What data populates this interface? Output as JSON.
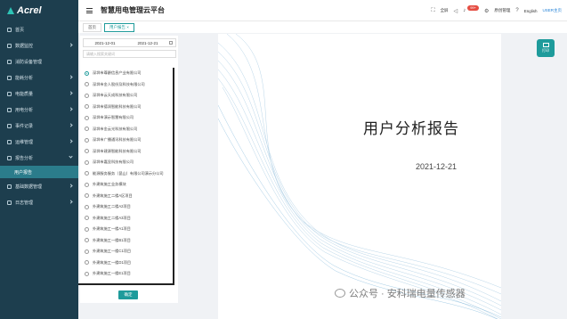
{
  "logo": {
    "text": "Acrel"
  },
  "sidebar": {
    "items": [
      {
        "label": "首页",
        "icon": "home-icon"
      },
      {
        "label": "数据监控",
        "icon": "monitor-icon"
      },
      {
        "label": "消防设备管理",
        "icon": "fire-icon"
      },
      {
        "label": "能耗分析",
        "icon": "energy-icon"
      },
      {
        "label": "电能质量",
        "icon": "quality-icon"
      },
      {
        "label": "用电分析",
        "icon": "chart-icon"
      },
      {
        "label": "事件记录",
        "icon": "event-icon"
      },
      {
        "label": "运维管理",
        "icon": "tool-icon"
      },
      {
        "label": "报告分析",
        "icon": "report-icon",
        "open": true
      },
      {
        "label": "基础数据管理",
        "icon": "database-icon"
      },
      {
        "label": "日志管理",
        "icon": "log-icon"
      }
    ],
    "subitem": {
      "label": "用户报告"
    }
  },
  "header": {
    "title": "智慧用电管理云平台",
    "fullscreen": "全屏",
    "badge": "99+",
    "feedback": "原创管理",
    "lang": "English",
    "user": "USER主页"
  },
  "tabs": [
    {
      "label": "首页"
    },
    {
      "label": "用户报告 ×"
    }
  ],
  "filter": {
    "start_date": "2021-12-01",
    "end_date": "2021-12-21",
    "search_placeholder": "请输入搜索关键词"
  },
  "companies": [
    "深圳市尊爵信息产业有限公司",
    "深圳市金人股份及科技有限公司",
    "深圳市云天成科技有限公司",
    "深圳市德润智能科技有限公司",
    "深圳市演示智慧有限公司",
    "深圳市金云光科技有限公司",
    "深圳市广播通讯科技有限公司",
    "深圳市建源智能科技有限公司",
    "深圳市嘉显科技有限公司",
    "能源服务服务（昆山）有限公司演示分公司",
    "外建筑施工业务模块",
    "外建筑施工二楼A区项目",
    "外建筑施工二楼A2项目",
    "外建筑施工二楼A3项目",
    "外建筑施工一楼A1项目",
    "外建筑施工一楼B1项目",
    "外建筑施工一楼C1项目",
    "外建筑施工一楼D1项目",
    "外建筑施工一楼E1项目"
  ],
  "confirm_label": "确定",
  "report": {
    "title": "用户分析报告",
    "date": "2021-12-21"
  },
  "print_label": "打印",
  "watermark": "公众号 · 安科瑞电量传感器",
  "colors": {
    "sidebar": "#1d3e4e",
    "accent": "#1e9b9b",
    "badge": "#e54d42"
  }
}
